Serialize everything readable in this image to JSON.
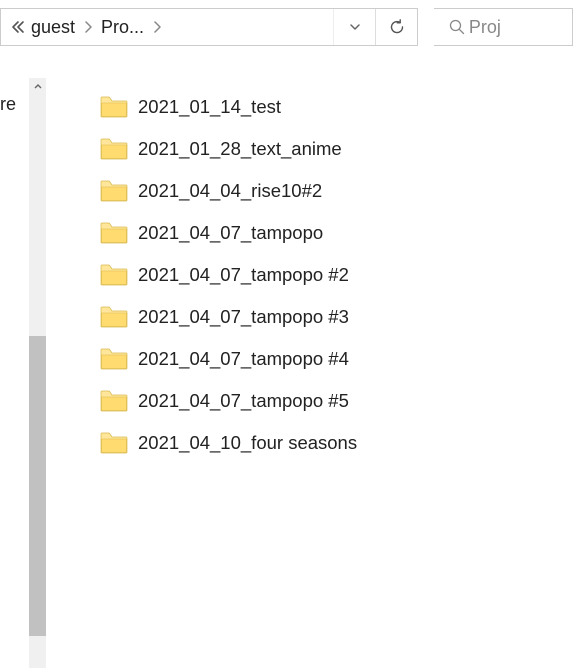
{
  "breadcrumb": {
    "seg1": "guest",
    "seg2": "Pro..."
  },
  "search": {
    "placeholder": "Proj"
  },
  "sidebar": {
    "fragment": "ere"
  },
  "folders": [
    {
      "name": "2021_01_14_test"
    },
    {
      "name": "2021_01_28_text_anime"
    },
    {
      "name": "2021_04_04_rise10#2"
    },
    {
      "name": "2021_04_07_tampopo"
    },
    {
      "name": "2021_04_07_tampopo #2"
    },
    {
      "name": "2021_04_07_tampopo #3"
    },
    {
      "name": "2021_04_07_tampopo #4"
    },
    {
      "name": "2021_04_07_tampopo #5"
    },
    {
      "name": "2021_04_10_four seasons"
    }
  ]
}
